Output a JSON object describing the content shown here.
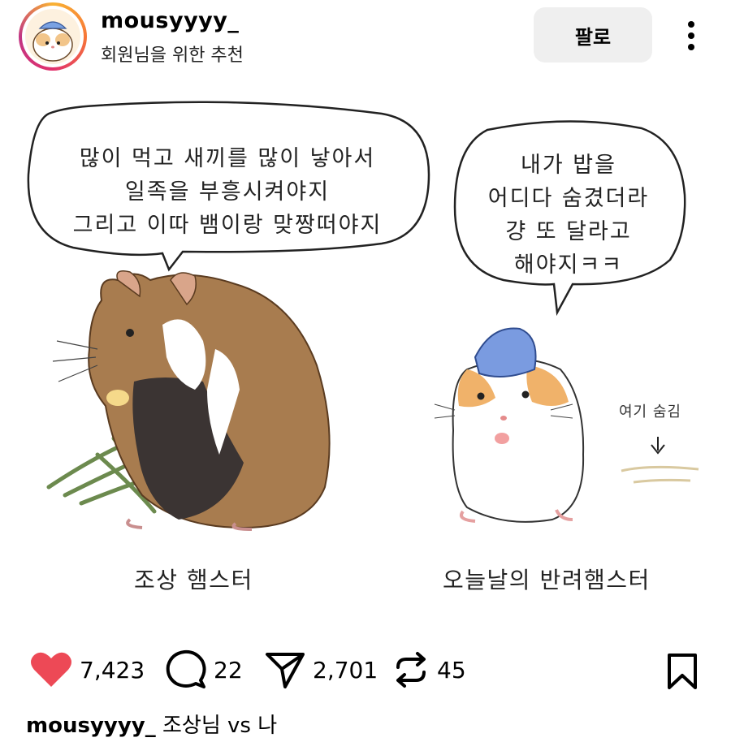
{
  "header": {
    "username": "mousyyyy_",
    "subtitle": "회원님을 위한 추천",
    "follow_label": "팔로",
    "more_icon": "more-vertical-icon"
  },
  "post": {
    "left_bubble": "많이 먹고 새끼를 많이 낳아서\n일족을 부흥시켜야지\n그리고 이따 뱀이랑 맞짱떠야지",
    "right_bubble": "내가 밥을\n어디다 숨겼더라\n걍 또 달라고\n해야지ㅋㅋ",
    "left_caption": "조상 햄스터",
    "right_caption": "오늘날의 반려햄스터",
    "hidden_label": "여기 숨김"
  },
  "actions": {
    "likes": "7,423",
    "comments": "22",
    "shares": "2,701",
    "reposts": "45"
  },
  "caption": {
    "username": "mousyyyy_",
    "text": "조상님 vs 나"
  },
  "colors": {
    "like_red": "#ed4956",
    "follow_bg": "#efefef"
  }
}
